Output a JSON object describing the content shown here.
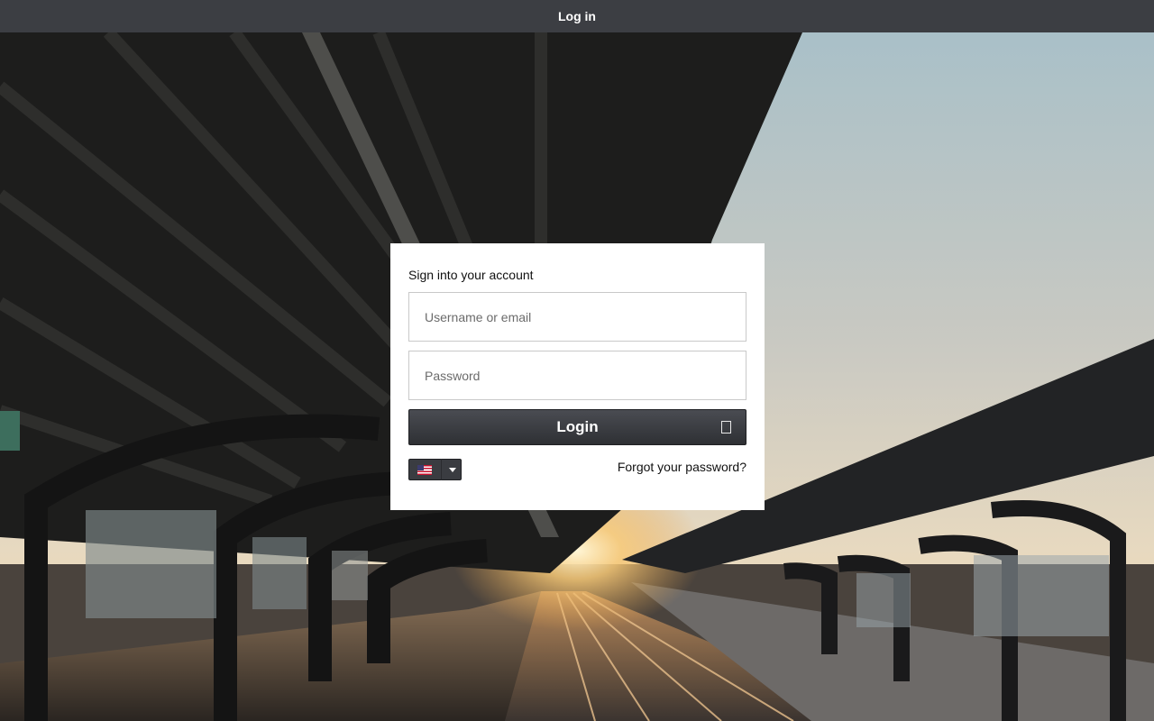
{
  "window": {
    "title": "Log in"
  },
  "login": {
    "heading": "Sign into your account",
    "username_placeholder": "Username or email",
    "password_placeholder": "Password",
    "login_label": "Login",
    "forgot_label": "Forgot your password?",
    "language": {
      "selected": "English (US)",
      "flag_icon": "us-flag-icon",
      "dropdown_icon": "caret-down-icon"
    }
  },
  "background": {
    "subject": "train-station-platform-photo"
  },
  "colors": {
    "topbar_bg": "#3c3e43",
    "button_bg": "#3a3c41",
    "card_bg": "#ffffff"
  }
}
